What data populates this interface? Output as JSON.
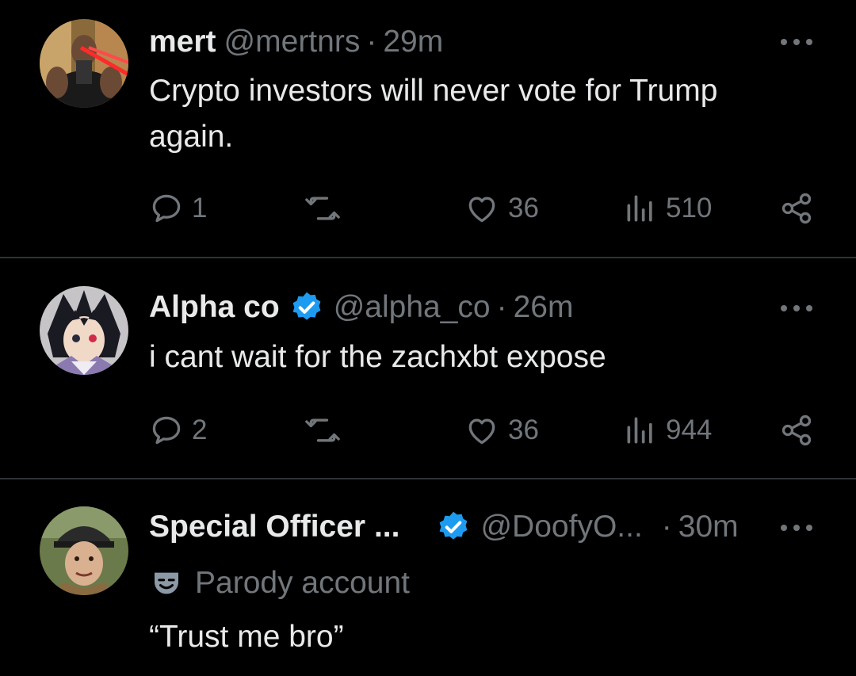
{
  "tweets": [
    {
      "name": "mert",
      "handle": "@mertnrs",
      "separator": "·",
      "time": "29m",
      "verified": false,
      "text": "Crypto investors will never vote for Trump again.",
      "avatar_icon": "muscular-man-laser-eyes-avatar",
      "replies": "1",
      "likes": "36",
      "views": "510"
    },
    {
      "name": "Alpha co",
      "handle": "@alpha_co",
      "separator": "·",
      "time": "26m",
      "verified": true,
      "text": "i cant wait for the zachxbt expose",
      "avatar_icon": "anime-character-avatar",
      "replies": "2",
      "likes": "36",
      "views": "944"
    },
    {
      "name": "Special Officer ...",
      "handle": "@DoofyO...",
      "separator": "·",
      "time": "30m",
      "verified": true,
      "parody_label": "Parody account",
      "text": "“Trust me bro”",
      "avatar_icon": "man-with-cap-avatar"
    }
  ],
  "colors": {
    "background": "#000000",
    "primary_text": "#e7e9ea",
    "secondary_text": "#71767b",
    "verified_blue": "#1d9bf0",
    "divider": "#2f3336"
  }
}
